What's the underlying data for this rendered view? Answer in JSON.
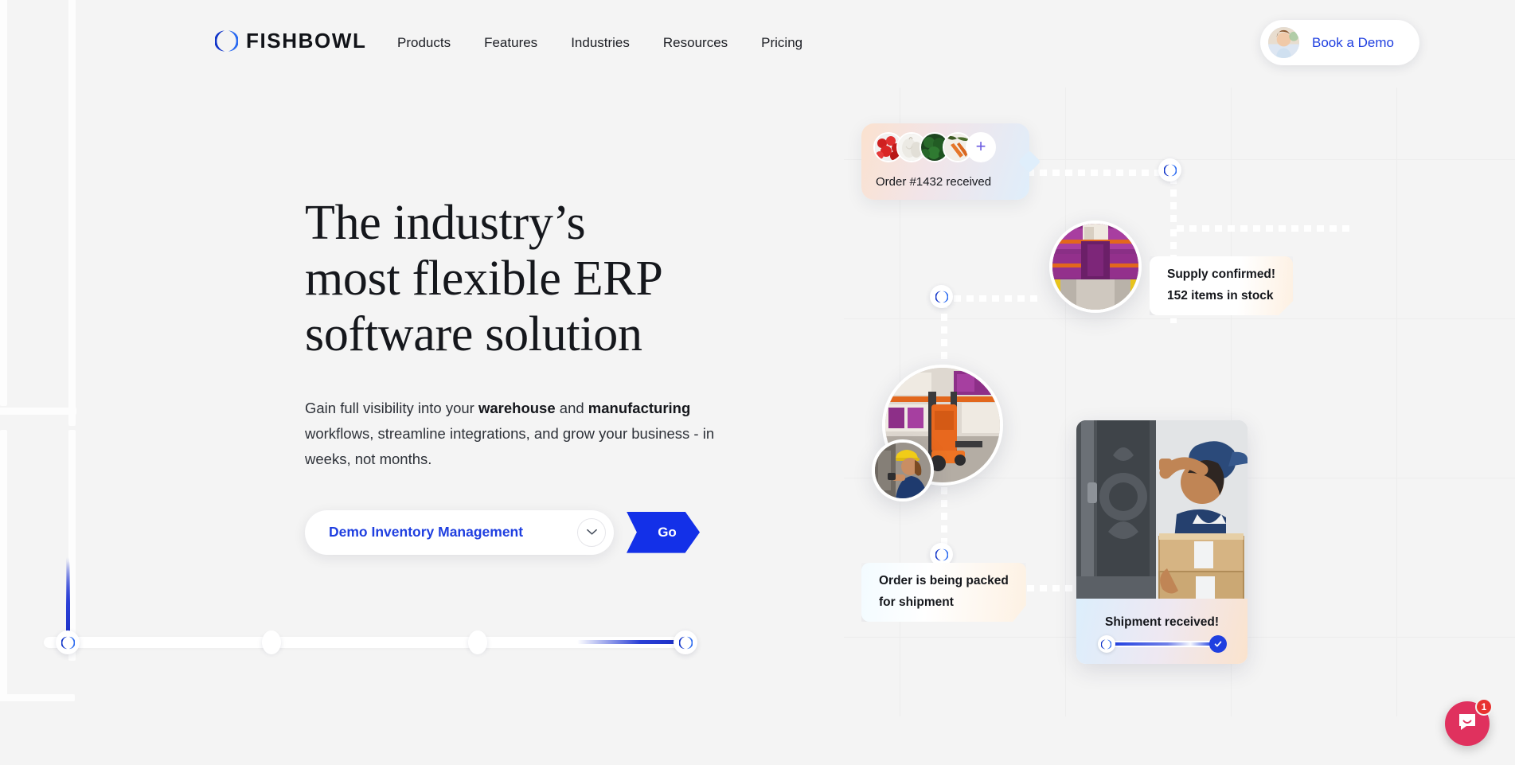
{
  "brand": {
    "name": "FISHBOWL",
    "accent_blue": "#1f3fe0",
    "cta_blue": "#1330e8",
    "page_bg": "#f4f4f4"
  },
  "header": {
    "logo_label": "FISHBOWL",
    "nav_items": [
      {
        "label": "Products"
      },
      {
        "label": "Features"
      },
      {
        "label": "Industries"
      },
      {
        "label": "Resources"
      },
      {
        "label": "Pricing"
      }
    ],
    "demo_button": {
      "label": "Book a Demo",
      "avatar_alt": "sales-rep-avatar"
    }
  },
  "hero": {
    "headline_line1": "The industry’s",
    "headline_line2": "most flexible ERP",
    "headline_line3": "software solution",
    "sub_part1": "Gain full visibility into your ",
    "sub_bold1": "warehouse",
    "sub_part2": " and ",
    "sub_bold2": "manufacturing",
    "sub_part3": " workflows, streamline integrations, and grow your business - in weeks, not months.",
    "select_value": "Demo Inventory Management",
    "go_label": "Go"
  },
  "illustration": {
    "order_card": {
      "caption": "Order #1432 received",
      "add_label": "+",
      "thumbs": [
        "tomatoes",
        "garlic",
        "leafy-greens",
        "carrots"
      ]
    },
    "supply_tooltip": {
      "line1": "Supply confirmed!",
      "line2": "152 items in stock"
    },
    "pack_tooltip": {
      "line1": "Order is being packed",
      "line2": "for shipment"
    },
    "shipment_card": {
      "caption": "Shipment received!",
      "photo_alt": "delivery-courier-at-door"
    },
    "photos": {
      "warehouse_aisle": "warehouse-shelves-aisle",
      "forklift": "warehouse-forklift",
      "worker": "warehouse-worker-scanning"
    }
  },
  "chat_widget": {
    "badge_count": "1",
    "icon": "chat-bubble-icon"
  }
}
